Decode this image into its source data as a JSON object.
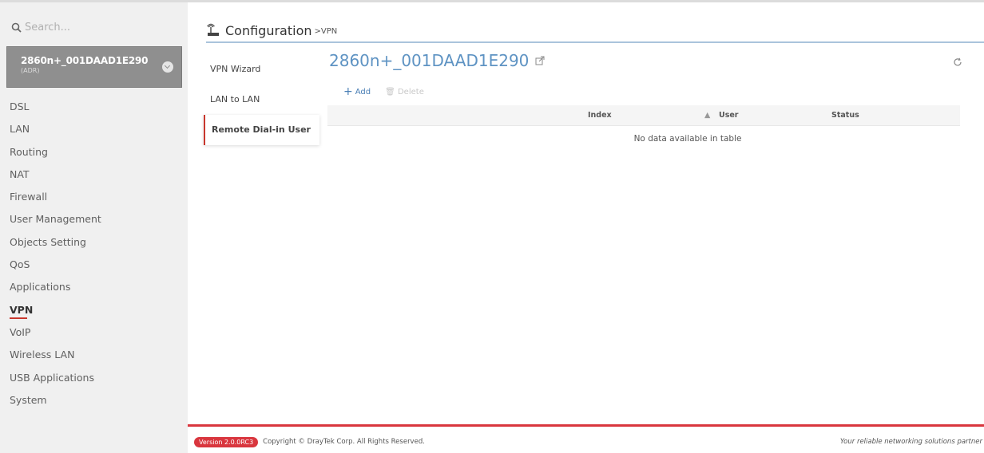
{
  "sidebar": {
    "search_placeholder": "Search...",
    "device": {
      "name": "2860n+_001DAAD1E290",
      "sub": "(ADR)"
    },
    "items": [
      {
        "label": "DSL"
      },
      {
        "label": "LAN"
      },
      {
        "label": "Routing"
      },
      {
        "label": "NAT"
      },
      {
        "label": "Firewall"
      },
      {
        "label": "User Management"
      },
      {
        "label": "Objects Setting"
      },
      {
        "label": "QoS"
      },
      {
        "label": "Applications"
      },
      {
        "label": "VPN"
      },
      {
        "label": "VoIP"
      },
      {
        "label": "Wireless LAN"
      },
      {
        "label": "USB Applications"
      },
      {
        "label": "System"
      }
    ],
    "active_item": "VPN"
  },
  "header": {
    "title": "Configuration",
    "breadcrumb": ">VPN"
  },
  "subnav": {
    "items": [
      {
        "label": "VPN Wizard"
      },
      {
        "label": "LAN to LAN"
      },
      {
        "label": "Remote Dial-in User"
      }
    ],
    "active_item": "Remote Dial-in User"
  },
  "main": {
    "device_title": "2860n+_001DAAD1E290",
    "toolbar": {
      "add_label": "Add",
      "delete_label": "Delete"
    },
    "table": {
      "columns": [
        "Index",
        "User",
        "Status"
      ],
      "rows": [],
      "empty_message": "No data available in table"
    }
  },
  "footer": {
    "version": "Version 2.0.0RC3",
    "copyright": "Copyright © DrayTek Corp. All Rights Reserved.",
    "tagline": "Your reliable networking solutions partner"
  },
  "colors": {
    "accent_red": "#d9363e",
    "title_blue": "#5e93c3",
    "link_blue": "#4a7fb5"
  }
}
